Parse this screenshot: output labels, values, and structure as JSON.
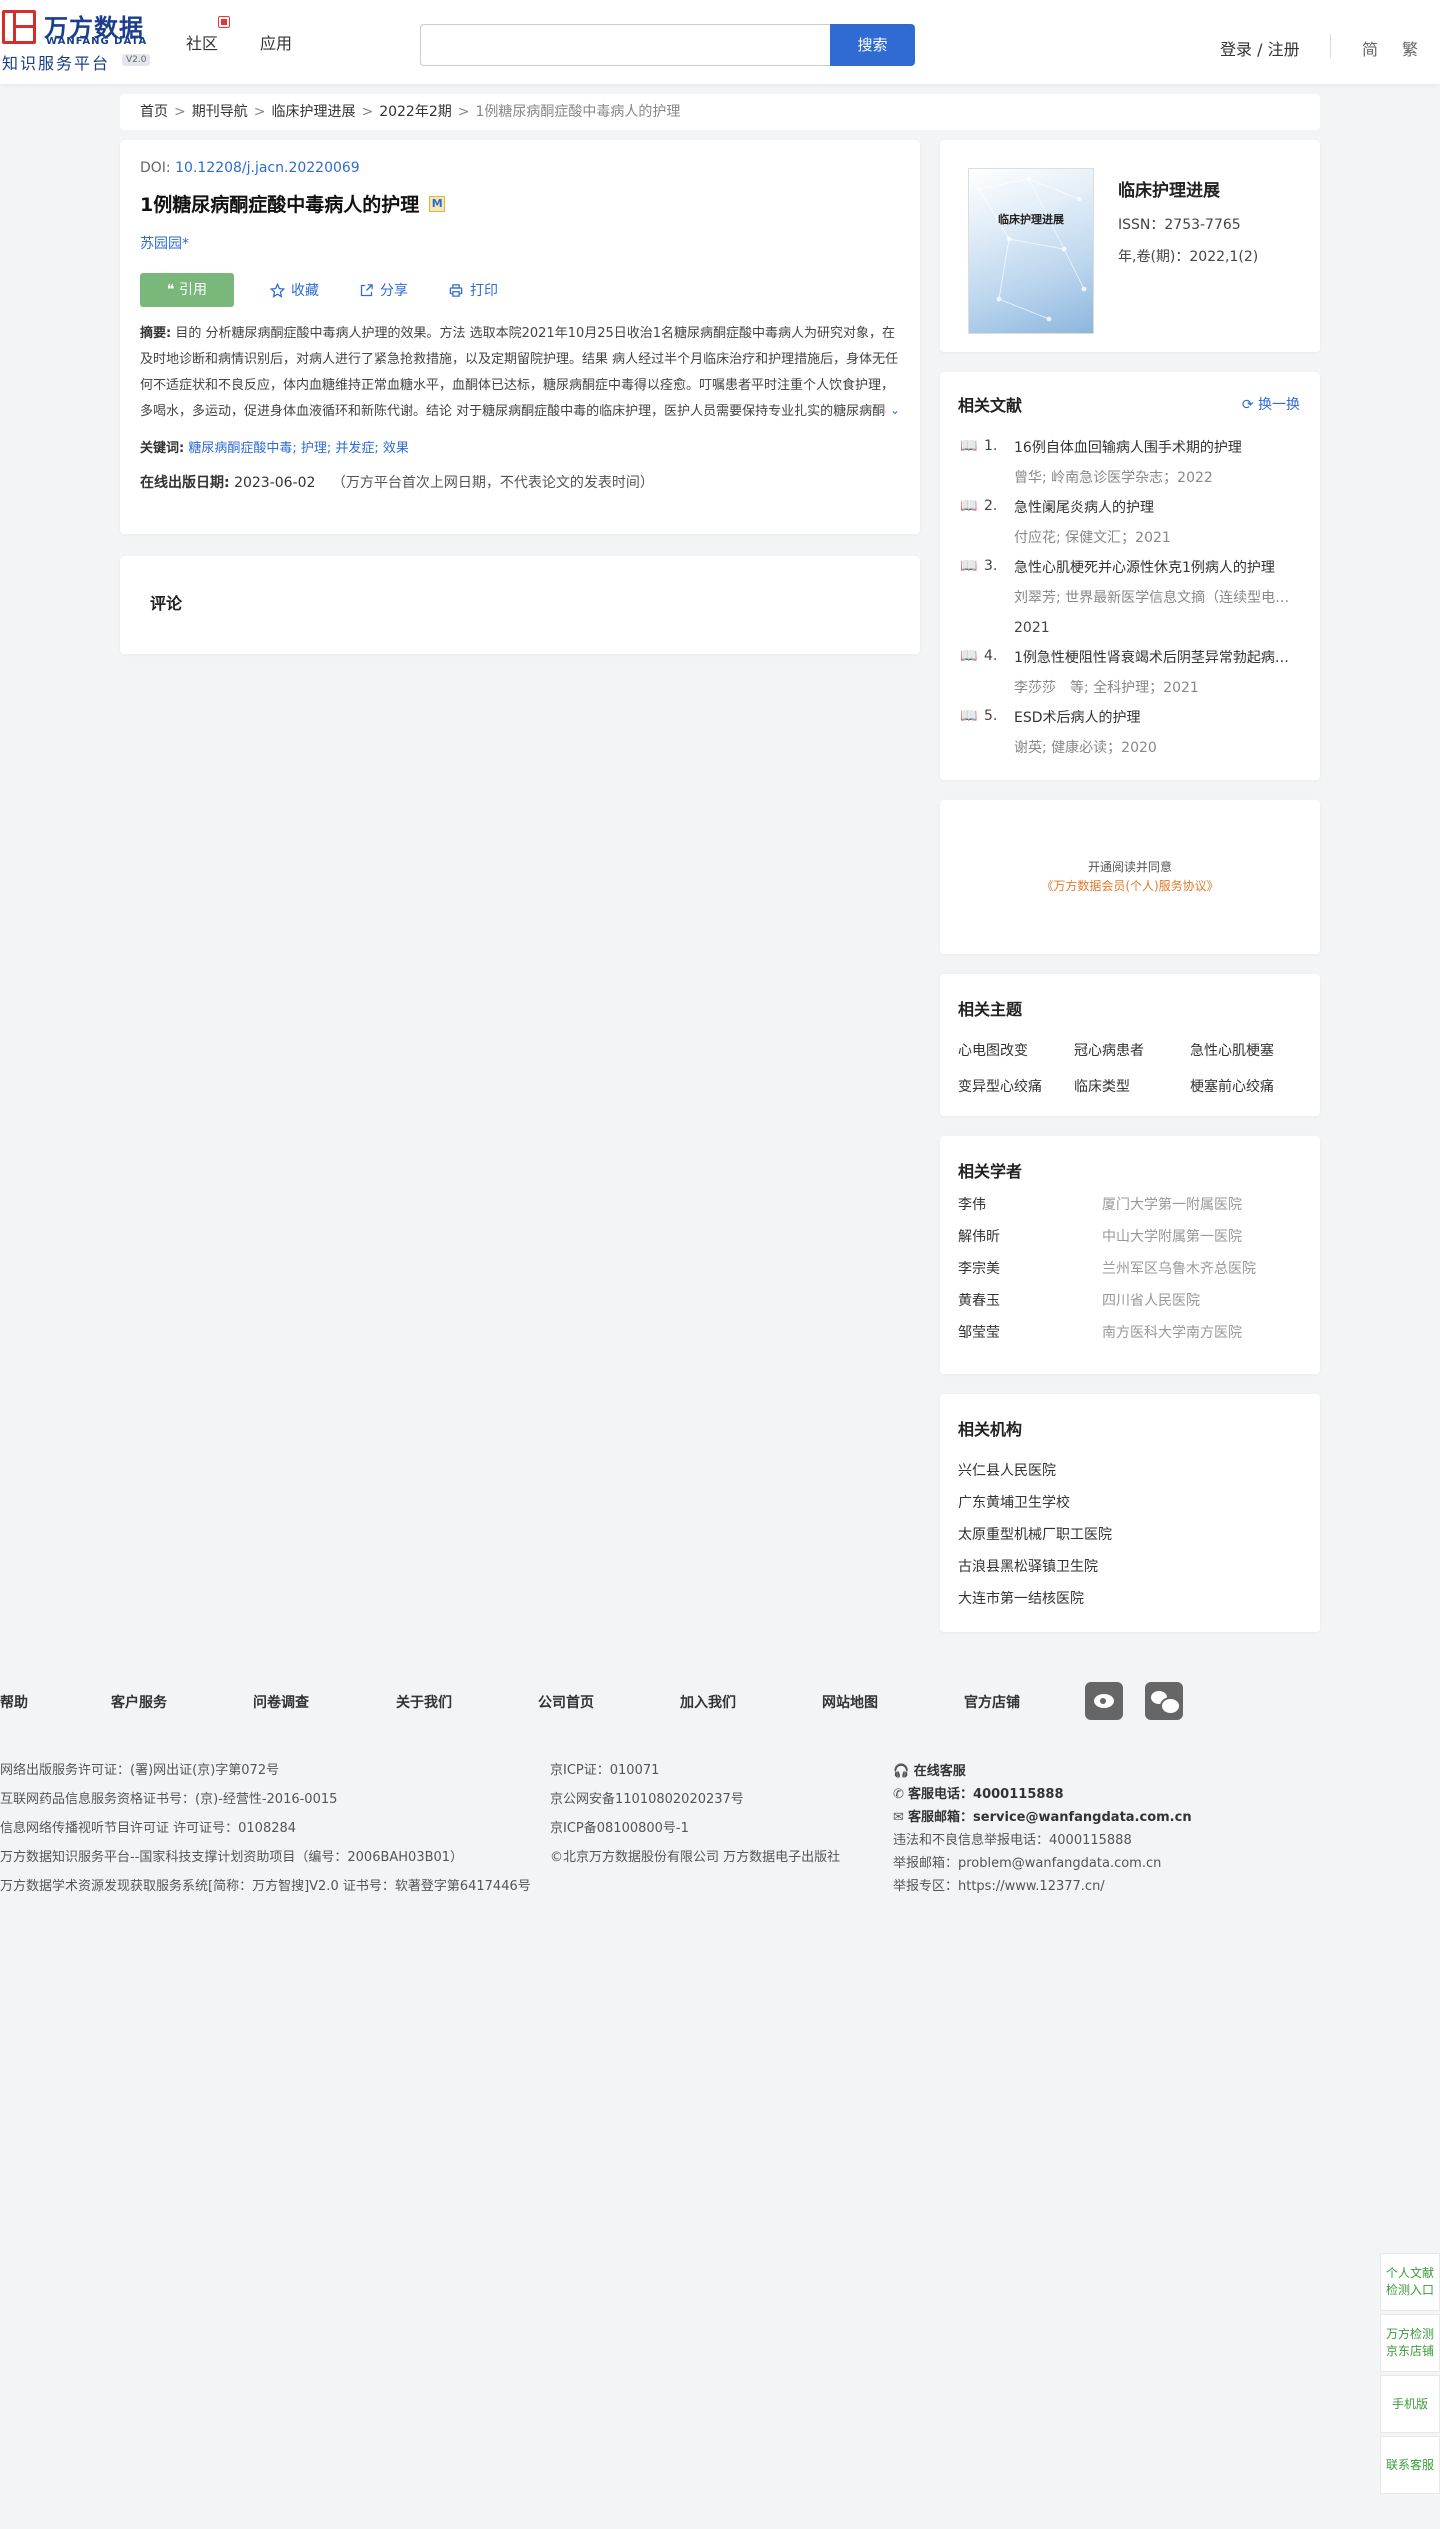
{
  "header": {
    "logo_cn": "万方数据",
    "logo_en": "WANFANG DATA",
    "logo_platform": "知识服务平台",
    "logo_version": "V2.0",
    "nav": [
      "社区",
      "应用"
    ],
    "search_placeholder": "",
    "search_button": "搜索",
    "login": "登录 / 注册",
    "lang_simplified": "简",
    "lang_traditional": "繁"
  },
  "breadcrumb": [
    "首页",
    "期刊导航",
    "临床护理进展",
    "2022年2期",
    "1例糖尿病酮症酸中毒病人的护理"
  ],
  "article": {
    "doi_label": "DOI:",
    "doi": "10.12208/j.jacn.20220069",
    "title": "1例糖尿病酮症酸中毒病人的护理",
    "title_badge": "M",
    "author": "苏园园*",
    "actions": {
      "cite": "引用",
      "collect": "收藏",
      "share": "分享",
      "print": "打印"
    },
    "abstract_label": "摘要:",
    "abstract": "目的 分析糖尿病酮症酸中毒病人护理的效果。方法 选取本院2021年10月25日收治1名糖尿病酮症酸中毒病人为研究对象，在及时地诊断和病情识别后，对病人进行了紧急抢救措施，以及定期留院护理。结果 病人经过半个月临床治疗和护理措施后，身体无任何不适症状和不良反应，体内血糖维持正常血糖水平，血酮体已达标，糖尿病酮症中毒得以痊愈。叮嘱患者平时注重个人饮食护理，多喝水，多运动，促进身体血液循环和新陈代谢。结论 对于糖尿病酮症酸中毒的临床护理，医护人员需要保持专业扎实的糖尿病酮症酸中毒的护理知识，护理技术操作娴熟可靠，对血糖指标检测观察熟练掌...",
    "keywords_label": "关键词:",
    "keywords": "糖尿病酮症酸中毒; 护理; 并发症; 效果",
    "pubdate_label": "在线出版日期:",
    "pubdate": "2023-06-02",
    "pubdate_note": "（万方平台首次上网日期，不代表论文的发表时间）"
  },
  "comment": {
    "title": "评论"
  },
  "journal": {
    "cover_title": "临床护理进展",
    "name": "临床护理进展",
    "issn": "ISSN：2753-7765",
    "vol": "年,卷(期)：2022,1(2)"
  },
  "related": {
    "title": "相关文献",
    "refresh": "换一换",
    "items": [
      {
        "num": "1.",
        "title": "16例自体血回输病人围手术期的护理",
        "meta": "曾华; 岭南急诊医学杂志；2022"
      },
      {
        "num": "2.",
        "title": "急性阑尾炎病人的护理",
        "meta": "付应花; 保健文汇；2021"
      },
      {
        "num": "3.",
        "title": "急性心肌梗死并心源性休克1例病人的护理",
        "meta": "刘翠芳; 世界最新医学信息文摘（连续型电子…",
        "year": "2021"
      },
      {
        "num": "4.",
        "title": "1例急性梗阻性肾衰竭术后阴茎异常勃起病…",
        "meta": "李莎莎　等; 全科护理；2021"
      },
      {
        "num": "5.",
        "title": "ESD术后病人的护理",
        "meta": "谢英; 健康必读；2020"
      }
    ]
  },
  "openread": {
    "line1": "开通阅读并同意",
    "line2": "《万方数据会员(个人)服务协议》"
  },
  "topics": {
    "title": "相关主题",
    "items": [
      "心电图改变",
      "冠心病患者",
      "急性心肌梗塞",
      "变异型心绞痛",
      "临床类型",
      "梗塞前心绞痛"
    ]
  },
  "scholars": {
    "title": "相关学者",
    "items": [
      {
        "name": "李伟",
        "org": "厦门大学第一附属医院"
      },
      {
        "name": "解伟昕",
        "org": "中山大学附属第一医院"
      },
      {
        "name": "李宗美",
        "org": "兰州军区乌鲁木齐总医院"
      },
      {
        "name": "黄春玉",
        "org": "四川省人民医院"
      },
      {
        "name": "邹莹莹",
        "org": "南方医科大学南方医院"
      }
    ]
  },
  "orgs": {
    "title": "相关机构",
    "items": [
      "兴仁县人民医院",
      "广东黄埔卫生学校",
      "太原重型机械厂职工医院",
      "古浪县黑松驿镇卫生院",
      "大连市第一结核医院"
    ]
  },
  "footer": {
    "links": [
      "帮助",
      "客户服务",
      "问卷调查",
      "关于我们",
      "公司首页",
      "加入我们",
      "网站地图",
      "官方店铺"
    ],
    "col1": [
      "网络出版服务许可证：(署)网出证(京)字第072号",
      "互联网药品信息服务资格证书号：(京)-经营性-2016-0015",
      "信息网络传播视听节目许可证 许可证号：0108284",
      "万方数据知识服务平台--国家科技支撑计划资助项目（编号：2006BAH03B01）",
      "万方数据学术资源发现获取服务系统[简称：万方智搜]V2.0 证书号：软著登字第6417446号"
    ],
    "col2": [
      "京ICP证：010071",
      "京公网安备11010802020237号",
      "京ICP备08100800号-1",
      "©北京万方数据股份有限公司 万方数据电子出版社"
    ],
    "col3": {
      "online_service": "在线客服",
      "phone_label": "客服电话：",
      "phone": "4000115888",
      "email_label": "客服邮箱：",
      "email": "service@wanfangdata.com.cn",
      "report_phone": "违法和不良信息举报电话：4000115888",
      "report_email": "举报邮箱：problem@wanfangdata.com.cn",
      "report_zone": "举报专区：https://www.12377.cn/"
    }
  },
  "side": [
    "个人文献检测入口",
    "万方检测京东店铺",
    "手机版",
    "联系客服"
  ],
  "colors": {
    "brand_blue": "#2f6bd3",
    "cite_green": "#7ab77a",
    "logo_red": "#d72c2c",
    "side_green": "#3c9b3c"
  }
}
